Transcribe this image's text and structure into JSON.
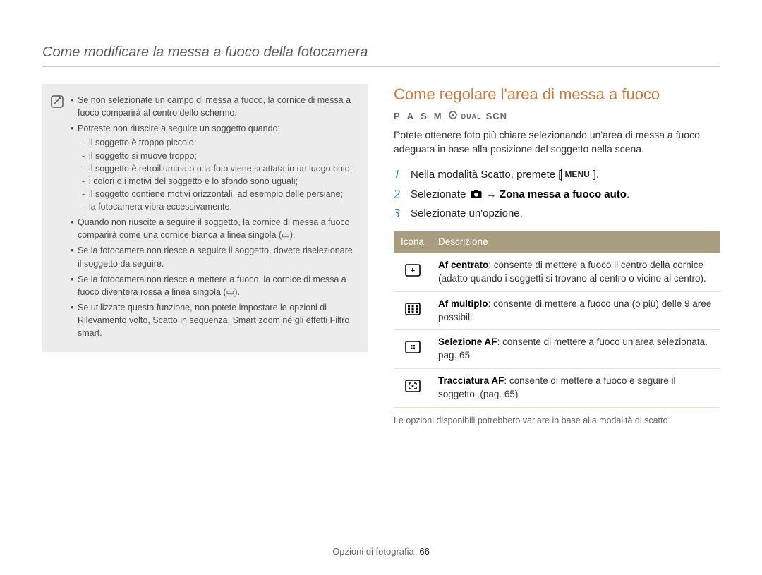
{
  "header": {
    "title": "Come modificare la messa a fuoco della fotocamera"
  },
  "note": {
    "icon_name": "notepad-icon",
    "bullets": [
      "Se non selezionate un campo di messa a fuoco, la cornice di messa a fuoco comparirà al centro dello schermo.",
      "Potreste non riuscire a seguire un soggetto quando:",
      "Quando non riuscite a seguire il soggetto, la cornice di messa a fuoco comparirà come una cornice bianca a linea singola (▭).",
      "Se la fotocamera non riesce a seguire il soggetto, dovete riselezionare il soggetto da seguire.",
      "Se la fotocamera non riesce a mettere a fuoco, la cornice di messa a fuoco diventerà rossa a linea singola (▭).",
      "Se utilizzate questa funzione, non potete impostare le opzioni di Rilevamento volto, Scatto in sequenza, Smart zoom né gli effetti Filtro smart."
    ],
    "sub_bullets": [
      "il soggetto è troppo piccolo;",
      "il soggetto si muove troppo;",
      "il soggetto è retroilluminato o la foto viene scattata in un luogo buio;",
      "i colori o i motivi del soggetto e lo sfondo sono uguali;",
      "il soggetto contiene motivi orizzontali, ad esempio delle persiane;",
      "la fotocamera vibra eccessivamente."
    ]
  },
  "section": {
    "title": "Come regolare l'area di messa a fuoco",
    "modes": {
      "p": "P",
      "a": "A",
      "s": "S",
      "m": "M",
      "dual": "DUAL",
      "scn": "SCN"
    },
    "intro": "Potete ottenere foto più chiare selezionando un'area di messa a fuoco adeguata in base alla posizione del soggetto nella scena.",
    "steps": [
      {
        "num": "1",
        "pre": "Nella modalità Scatto, premete [",
        "badge": "MENU",
        "post": "]."
      },
      {
        "num": "2",
        "pre": "Selezionate ",
        "icon": "camera-icon",
        "arrow": " → ",
        "bold": "Zona messa a fuoco auto",
        "post": "."
      },
      {
        "num": "3",
        "pre": "Selezionate un'opzione."
      }
    ],
    "table": {
      "head_icon": "Icona",
      "head_desc": "Descrizione",
      "rows": [
        {
          "icon": "af-center-icon",
          "bold": "Af centrato",
          "text": ": consente di mettere a fuoco il centro della cornice (adatto quando i soggetti si trovano al centro o vicino al centro)."
        },
        {
          "icon": "af-multi-icon",
          "bold": "Af multiplo",
          "text": ": consente di mettere a fuoco una (o più) delle 9 aree possibili."
        },
        {
          "icon": "af-selection-icon",
          "bold": "Selezione AF",
          "text": ": consente di mettere a fuoco un'area selezionata. pag. 65"
        },
        {
          "icon": "af-tracking-icon",
          "bold": "Tracciatura AF",
          "text": ": consente di mettere a fuoco e seguire il soggetto. (pag. 65)"
        }
      ]
    },
    "footnote": "Le opzioni disponibili potrebbero variare in base alla modalità di scatto."
  },
  "footer": {
    "label": "Opzioni di fotografia",
    "page": "66"
  }
}
